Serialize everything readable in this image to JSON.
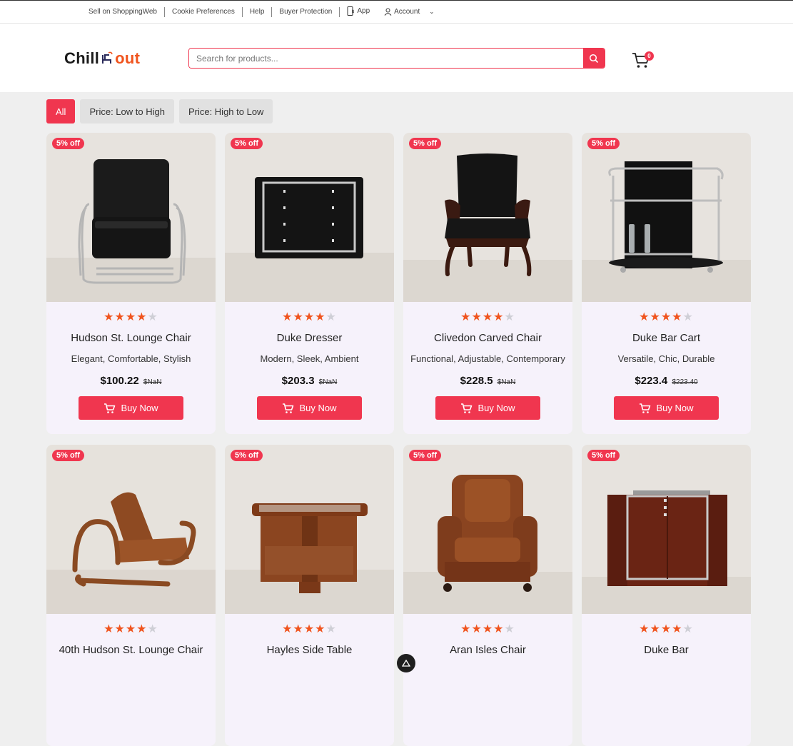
{
  "topbar": {
    "links": [
      "Sell on ShoppingWeb",
      "Cookie Preferences",
      "Help",
      "Buyer Protection"
    ],
    "app_label": "App",
    "account_label": "Account",
    "account_chevron": "⌄"
  },
  "header": {
    "logo_left": "Chill",
    "logo_right": "out",
    "search_placeholder": "Search for products...",
    "cart_count": "0"
  },
  "filters": [
    "All",
    "Price: Low to High",
    "Price: High to Low"
  ],
  "products": [
    {
      "badge": "5% off",
      "name": "Hudson St. Lounge Chair",
      "tags": "Elegant, Comfortable, Stylish",
      "price": "$100.22",
      "old_price": "$NaN",
      "rating": 4,
      "buy_label": "Buy Now"
    },
    {
      "badge": "5% off",
      "name": "Duke Dresser",
      "tags": "Modern, Sleek, Ambient",
      "price": "$203.3",
      "old_price": "$NaN",
      "rating": 4,
      "buy_label": "Buy Now"
    },
    {
      "badge": "5% off",
      "name": "Clivedon Carved Chair",
      "tags": "Functional, Adjustable, Contemporary",
      "price": "$228.5",
      "old_price": "$NaN",
      "rating": 4,
      "buy_label": "Buy Now"
    },
    {
      "badge": "5% off",
      "name": "Duke Bar Cart",
      "tags": "Versatile, Chic, Durable",
      "price": "$223.4",
      "old_price": "$223.40",
      "rating": 4,
      "buy_label": "Buy Now"
    },
    {
      "badge": "5% off",
      "name": "40th Hudson St. Lounge Chair",
      "tags": "",
      "price": "",
      "old_price": "",
      "rating": 4,
      "buy_label": ""
    },
    {
      "badge": "5% off",
      "name": "Hayles Side Table",
      "tags": "",
      "price": "",
      "old_price": "",
      "rating": 4,
      "buy_label": ""
    },
    {
      "badge": "5% off",
      "name": "Aran Isles Chair",
      "tags": "",
      "price": "",
      "old_price": "",
      "rating": 4,
      "buy_label": ""
    },
    {
      "badge": "5% off",
      "name": "Duke Bar",
      "tags": "",
      "price": "",
      "old_price": "",
      "rating": 4,
      "buy_label": ""
    }
  ],
  "colors": {
    "accent": "#f0364f",
    "star": "#f0541e",
    "logo_orange": "#f0541e"
  }
}
